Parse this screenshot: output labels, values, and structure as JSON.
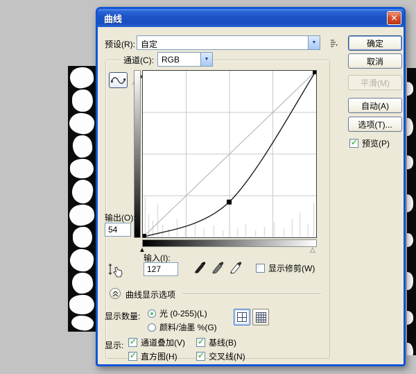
{
  "window": {
    "title": "曲线"
  },
  "icons": {
    "close": "✕",
    "dropdown": "▼",
    "check": "✓",
    "black_slider": "▲",
    "white_slider": "△"
  },
  "preset": {
    "label": "预设(R):",
    "value": "自定"
  },
  "channel": {
    "label": "通道(C):",
    "value": "RGB"
  },
  "actions": {
    "ok": "确定",
    "cancel": "取消",
    "smooth": "平滑(M)",
    "auto": "自动(A)",
    "options": "选项(T)...",
    "preview": "预览(P)"
  },
  "fields": {
    "output_label": "输出(O):",
    "output_value": "54",
    "input_label": "输入(I):",
    "input_value": "127"
  },
  "clipping": {
    "label": "显示修剪(W)",
    "checked": false
  },
  "display_options": {
    "header": "曲线显示选项",
    "amount_label": "显示数量:",
    "radios": [
      {
        "label": "光 (0-255)(L)",
        "selected": true
      },
      {
        "label": "颜料/油墨 %(G)",
        "selected": false
      }
    ],
    "show_label": "显示:",
    "checkboxes": [
      {
        "label": "通道叠加(V)",
        "checked": true
      },
      {
        "label": "基线(B)",
        "checked": true
      },
      {
        "label": "直方图(H)",
        "checked": true
      },
      {
        "label": "交叉线(N)",
        "checked": true
      }
    ]
  },
  "chart_data": {
    "type": "line",
    "title": "RGB tone curve",
    "x_range": [
      0,
      255
    ],
    "y_range": [
      0,
      255
    ],
    "grid_divisions": 4,
    "curve_points": [
      [
        0,
        0
      ],
      [
        127,
        54
      ],
      [
        255,
        255
      ]
    ],
    "selected_point": {
      "input": 127,
      "output": 54
    },
    "baseline": [
      [
        0,
        0
      ],
      [
        255,
        255
      ]
    ],
    "histogram": [
      [
        3,
        0.5
      ],
      [
        8,
        0.28
      ],
      [
        14,
        0.2
      ],
      [
        21,
        0.4
      ],
      [
        29,
        0.15
      ],
      [
        38,
        0.1
      ],
      [
        50,
        0.22
      ],
      [
        62,
        0.12
      ],
      [
        76,
        0.18
      ],
      [
        90,
        0.1
      ],
      [
        104,
        0.14
      ],
      [
        117,
        0.08
      ],
      [
        127,
        0.2
      ],
      [
        139,
        0.1
      ],
      [
        151,
        0.16
      ],
      [
        165,
        0.08
      ],
      [
        179,
        0.12
      ],
      [
        193,
        0.18
      ],
      [
        207,
        0.1
      ],
      [
        219,
        0.22
      ],
      [
        231,
        0.3
      ],
      [
        243,
        0.16
      ],
      [
        251,
        0.42
      ]
    ]
  },
  "colors": {
    "titlebar_blue": "#1c53c5",
    "dialog_bg": "#ece9d8",
    "dialog_border": "#0f54d8",
    "check_green": "#21a121",
    "curve": "#1c1c1c",
    "baseline_gray": "#b9b9b9"
  }
}
